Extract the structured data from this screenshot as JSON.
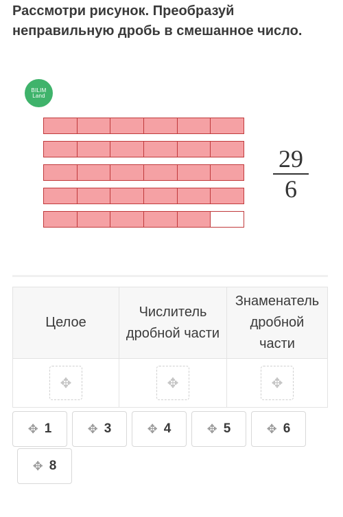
{
  "question": "Рассмотри рисунок. Преобразуй неправильную дробь в смешанное число.",
  "logo": {
    "line1": "BILIM",
    "line2": "Land"
  },
  "figure": {
    "strips": [
      {
        "filled": 6,
        "total": 6
      },
      {
        "filled": 6,
        "total": 6
      },
      {
        "filled": 6,
        "total": 6
      },
      {
        "filled": 6,
        "total": 6
      },
      {
        "filled": 5,
        "total": 6
      }
    ],
    "fill_color": "#f5a1a4",
    "border_color": "#c0393b"
  },
  "fraction": {
    "numerator": "29",
    "denominator": "6"
  },
  "table": {
    "headers": [
      "Целое",
      "Числитель дробной части",
      "Знаменатель дробной части"
    ]
  },
  "icons": {
    "move": "move-icon",
    "dropzone": "move-target-icon"
  },
  "options": [
    "1",
    "3",
    "4",
    "5",
    "6",
    "8"
  ],
  "accent": "#3fb36b"
}
